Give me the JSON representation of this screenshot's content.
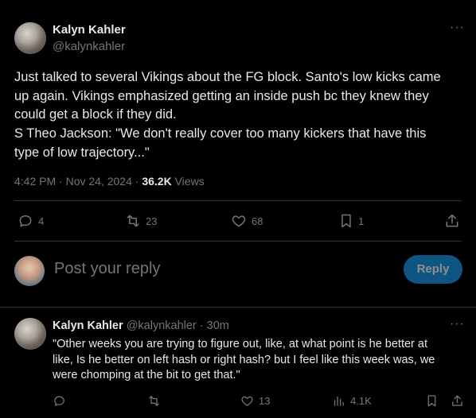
{
  "post": {
    "author_name": "Kalyn Kahler",
    "author_handle": "@kalynkahler",
    "text_lines": [
      "Just talked to several Vikings about the FG block. Santo's low kicks came",
      "up again. Vikings emphasized getting an inside push bc they knew they",
      "could get a block if they did.",
      "S Theo Jackson: \"We don't really cover  too many kickers that have this",
      "type of low trajectory...\""
    ],
    "time": "4:42 PM",
    "date": "Nov 24, 2024",
    "views_count": "36.2K",
    "views_label": "Views",
    "sep": "·",
    "actions": {
      "replies": "4",
      "reposts": "23",
      "likes": "68",
      "bookmarks": "1"
    }
  },
  "reply_box": {
    "placeholder": "Post your reply",
    "button_label": "Reply"
  },
  "reply": {
    "author_name": "Kalyn Kahler",
    "author_handle": "@kalynkahler",
    "sep": "·",
    "age": "30m",
    "text_lines": [
      "\"Other weeks you are trying to figure out, like, at what point is he better at",
      "like, Is he better on left hash or right hash? but I feel like this week was, we",
      "were chomping at the bit to get that.\""
    ],
    "actions": {
      "likes": "13",
      "views": "4.1K"
    }
  },
  "colors": {
    "background": "#000000",
    "text": "#e7e9ea",
    "muted": "#71767b",
    "divider": "#2f3336",
    "reply_button": "#1d9bf0"
  },
  "icons": [
    "more-icon",
    "reply-icon",
    "repost-icon",
    "like-icon",
    "bookmark-icon",
    "share-icon",
    "views-icon"
  ]
}
